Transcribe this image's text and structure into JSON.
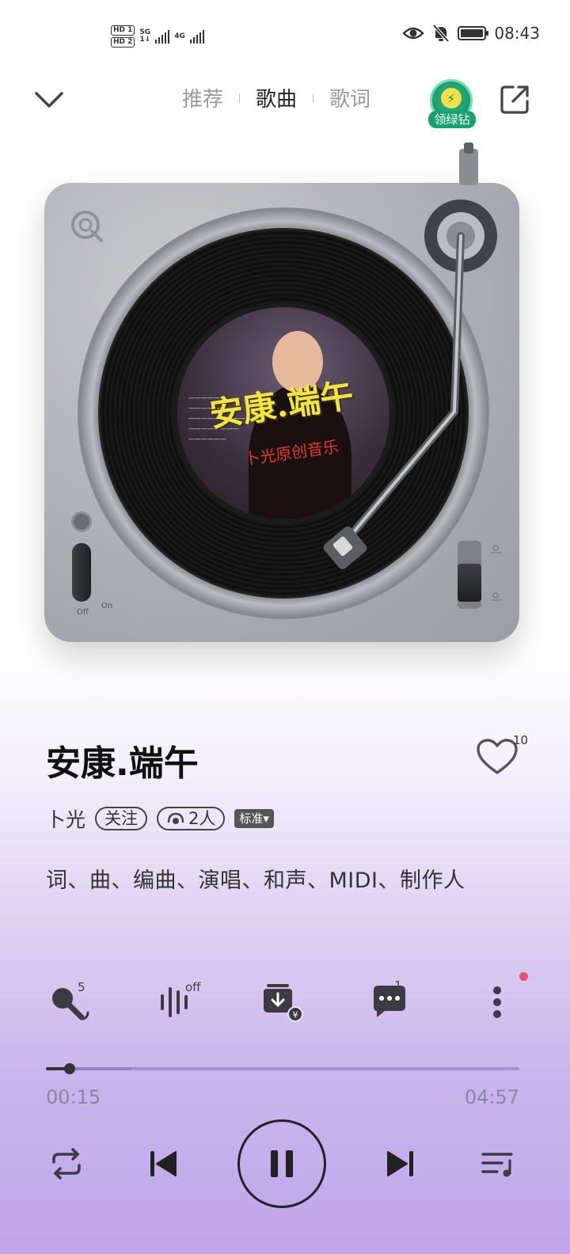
{
  "status_bar": {
    "hd1": "HD 1",
    "hd2": "HD 2",
    "net1": "5G",
    "net1_sub": "1↓",
    "net2": "4G",
    "time": "08:43"
  },
  "nav": {
    "tabs": [
      {
        "label": "推荐",
        "active": false
      },
      {
        "label": "歌曲",
        "active": true
      },
      {
        "label": "歌词",
        "active": false
      }
    ],
    "vip_label": "领绿钻"
  },
  "cover": {
    "title": "安康.端午",
    "subtitle": "卜光原创音乐",
    "switch_off": "Off",
    "switch_on": "On"
  },
  "song": {
    "title": "安康.端午",
    "artist": "卜光",
    "follow_label": "关注",
    "listeners": "2人",
    "quality": "标准▾",
    "likes": "10",
    "credits": "词、曲、编曲、演唱、和声、MIDI、制作人"
  },
  "actions": {
    "karaoke_count": "5",
    "effect_state": "off",
    "comment_count": "1"
  },
  "progress": {
    "current": "00:15",
    "total": "04:57",
    "played_fraction": 0.05,
    "buffered_fraction": 0.18
  },
  "colors": {
    "vip_green": "#16a271",
    "lyric_title": "#f7e535",
    "notification_dot": "#f0506e",
    "progress_track": "#a792d6"
  }
}
